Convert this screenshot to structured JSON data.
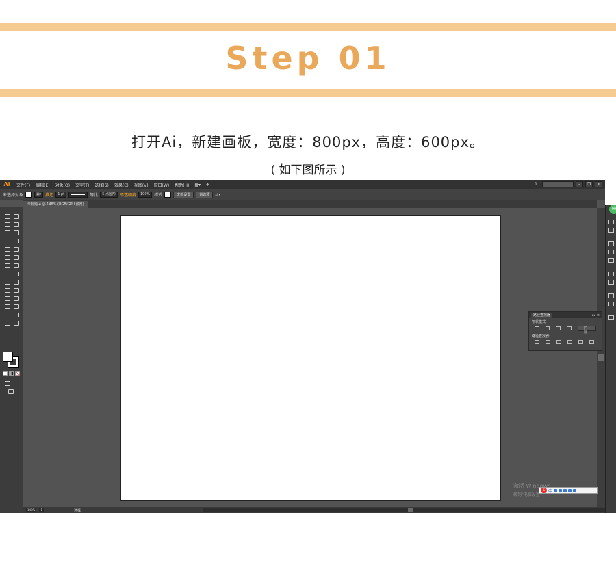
{
  "banner": {
    "title": "Step 01"
  },
  "instruction": "打开Ai，新建画板，宽度：800px，高度：600px。",
  "note": "( 如下图所示 )",
  "colors": {
    "band": "#f5cb91",
    "title": "#eaa95a",
    "canvas_bg": "#535353",
    "artboard": "#ffffff"
  },
  "app": {
    "logo": "Ai",
    "menus": [
      "文件(F)",
      "编辑(E)",
      "对象(O)",
      "文字(T)",
      "选择(S)",
      "效果(C)",
      "视图(V)",
      "窗口(W)",
      "帮助(H)"
    ],
    "workspace_num": "1",
    "control_bar": {
      "selection_label": "未选择对象",
      "stroke_label": "描边",
      "stroke_weight": "1 pt",
      "stroke_style": "等比",
      "brush": "5 点圆形",
      "opacity_label": "不透明度",
      "opacity_value": "100%",
      "style_label": "样式",
      "doc_setup_button": "文档设置",
      "preferences_button": "首选项"
    },
    "document_tab": "未标题-4 @ 148% (RGB/GPU 预览)",
    "pathfinder": {
      "title": "路径查找器",
      "shape_modes_label": "形状模式:",
      "expand_button": "扩展",
      "pathfinders_label": "路径查找器:"
    },
    "watermark": {
      "line1": "激活 Windows",
      "line2": "转到\"电脑设置\""
    },
    "ime": {
      "text": "中"
    },
    "status": {
      "zoom": "148%",
      "page": "1",
      "tool_label": "选择"
    },
    "badge": "99"
  }
}
